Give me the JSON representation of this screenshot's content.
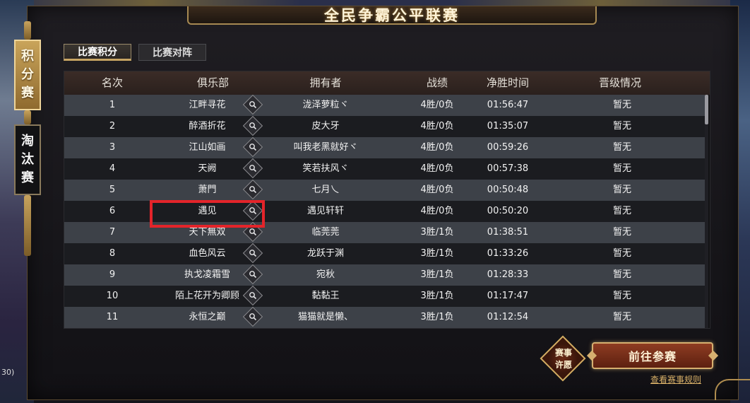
{
  "window": {
    "title": "全民争霸公平联赛"
  },
  "side_tabs": [
    {
      "label": "积分赛",
      "chars": [
        "积",
        "分",
        "赛"
      ],
      "active": true
    },
    {
      "label": "淘汰赛",
      "chars": [
        "淘",
        "汰",
        "赛"
      ],
      "active": false
    }
  ],
  "top_tabs": [
    {
      "label": "比赛积分",
      "active": true
    },
    {
      "label": "比赛对阵",
      "active": false
    }
  ],
  "table": {
    "headers": {
      "rank": "名次",
      "club": "俱乐部",
      "owner": "拥有者",
      "record": "战绩",
      "net_time": "净胜时间",
      "promotion": "晋级情况"
    },
    "rows": [
      {
        "rank": "1",
        "club": "江畔寻花",
        "owner": "泷泽萝粒ヾ",
        "record": "4胜/0负",
        "net_time": "01:56:47",
        "promotion": "暂无"
      },
      {
        "rank": "2",
        "club": "醉酒折花",
        "owner": "皮大牙",
        "record": "4胜/0负",
        "net_time": "01:35:07",
        "promotion": "暂无"
      },
      {
        "rank": "3",
        "club": "江山如画",
        "owner": "叫我老黑就好ヾ",
        "record": "4胜/0负",
        "net_time": "00:59:26",
        "promotion": "暂无"
      },
      {
        "rank": "4",
        "club": "天阙",
        "owner": "笑若扶风ヾ",
        "record": "4胜/0负",
        "net_time": "00:57:38",
        "promotion": "暂无"
      },
      {
        "rank": "5",
        "club": "萧門",
        "owner": "七月乀",
        "record": "4胜/0负",
        "net_time": "00:50:48",
        "promotion": "暂无"
      },
      {
        "rank": "6",
        "club": "遇见",
        "owner": "遇见轩轩",
        "record": "4胜/0负",
        "net_time": "00:50:20",
        "promotion": "暂无"
      },
      {
        "rank": "7",
        "club": "天下無双",
        "owner": "临莞莞",
        "record": "3胜/1负",
        "net_time": "01:38:51",
        "promotion": "暂无"
      },
      {
        "rank": "8",
        "club": "血色风云",
        "owner": "龙跃于渊",
        "record": "3胜/1负",
        "net_time": "01:33:26",
        "promotion": "暂无"
      },
      {
        "rank": "9",
        "club": "执戈凌霜雪",
        "owner": "宛秋",
        "record": "3胜/1负",
        "net_time": "01:28:33",
        "promotion": "暂无"
      },
      {
        "rank": "10",
        "club": "陌上花开为卿顾",
        "owner": "黏黏王",
        "record": "3胜/1负",
        "net_time": "01:17:47",
        "promotion": "暂无"
      },
      {
        "rank": "11",
        "club": "永恒之巅",
        "owner": "猫猫就是懒、",
        "record": "3胜/1负",
        "net_time": "01:12:54",
        "promotion": "暂无"
      }
    ],
    "highlighted_row_index": 5,
    "club_search_icon": "magnifier-icon"
  },
  "footer": {
    "wish_button": {
      "line1": "赛事",
      "line2": "许愿"
    },
    "go_button": "前往参赛",
    "rules_link": "查看赛事规则",
    "side_number": "30)"
  },
  "colors": {
    "accent_gold": "#c7a463",
    "highlight_red": "#e4242a",
    "go_button": "#8e3c22",
    "row_odd": "#3d4148",
    "row_even": "#1b1c20"
  }
}
